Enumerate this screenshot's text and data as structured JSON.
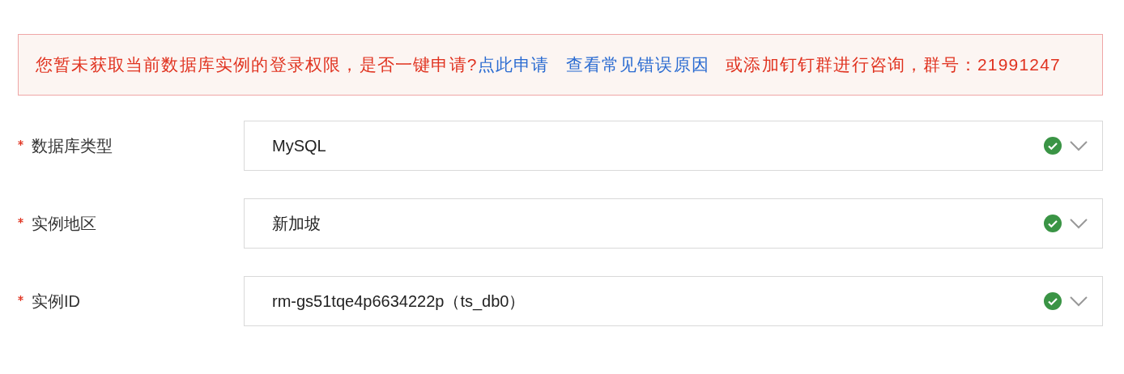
{
  "alert": {
    "segments": [
      {
        "kind": "text",
        "text": "您暂未获取当前数据库实例的登录权限，是否一键申请?"
      },
      {
        "kind": "link",
        "text": "点此申请"
      },
      {
        "kind": "link",
        "text": "查看常见错误原因"
      },
      {
        "kind": "text",
        "text": "或添加钉钉群进行咨询，群号：21991247"
      }
    ]
  },
  "fields": [
    {
      "label": "数据库类型",
      "required": true,
      "value": "MySQL",
      "valid": true
    },
    {
      "label": "实例地区",
      "required": true,
      "value": "新加坡",
      "valid": true
    },
    {
      "label": "实例ID",
      "required": true,
      "value": "rm-gs51tqe4p6634222p（ts_db0）",
      "valid": true
    }
  ]
}
